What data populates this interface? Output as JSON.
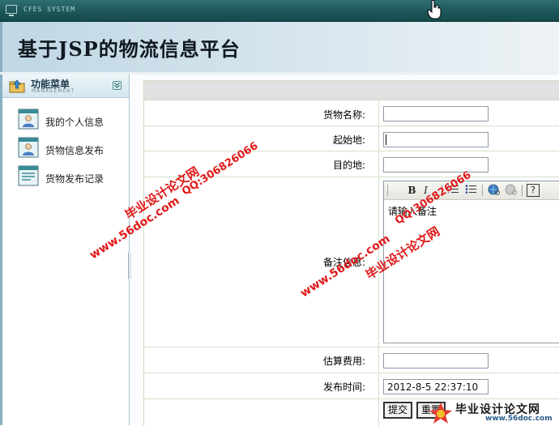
{
  "titlebar": {
    "system_name": "CFES SYSTEM"
  },
  "header": {
    "title": "基于JSP的物流信息平台"
  },
  "sidebar": {
    "menu_title": "功能菜单",
    "menu_subtitle": "MANAGEMENT",
    "items": [
      {
        "label": "我的个人信息",
        "icon": "user-card-icon"
      },
      {
        "label": "货物信息发布",
        "icon": "user-card-icon"
      },
      {
        "label": "货物发布记录",
        "icon": "form-icon"
      }
    ]
  },
  "form": {
    "goods_name": {
      "label": "货物名称:",
      "value": ""
    },
    "origin": {
      "label": "起始地:",
      "value": ""
    },
    "destination": {
      "label": "目的地:",
      "value": ""
    },
    "remarks": {
      "label": "备注信息:",
      "editor_text": "请输入备注"
    },
    "estimated_cost": {
      "label": "估算费用:",
      "value": ""
    },
    "publish_time": {
      "label": "发布时间:",
      "value": "2012-8-5 22:37:10"
    },
    "submit_label": "提交",
    "reset_label": "重置"
  },
  "editor_toolbar": {
    "buttons": [
      "bold-icon",
      "italic-icon",
      "ordered-list-icon",
      "unordered-list-icon",
      "link-icon",
      "unlink-icon",
      "help-icon"
    ],
    "bold": "B",
    "italic": "I",
    "help": "?"
  },
  "watermarks": {
    "site_name": "毕业设计论文网",
    "qq": "QQ:306826066",
    "url": "www.56doc.com",
    "footer_name": "毕业设计论文网",
    "footer_url": "www.56doc.com"
  },
  "colors": {
    "titlebar": "#1d5759",
    "header": "#c8dde8",
    "watermark": "#e11919",
    "table_border": "#d4e0c8"
  }
}
